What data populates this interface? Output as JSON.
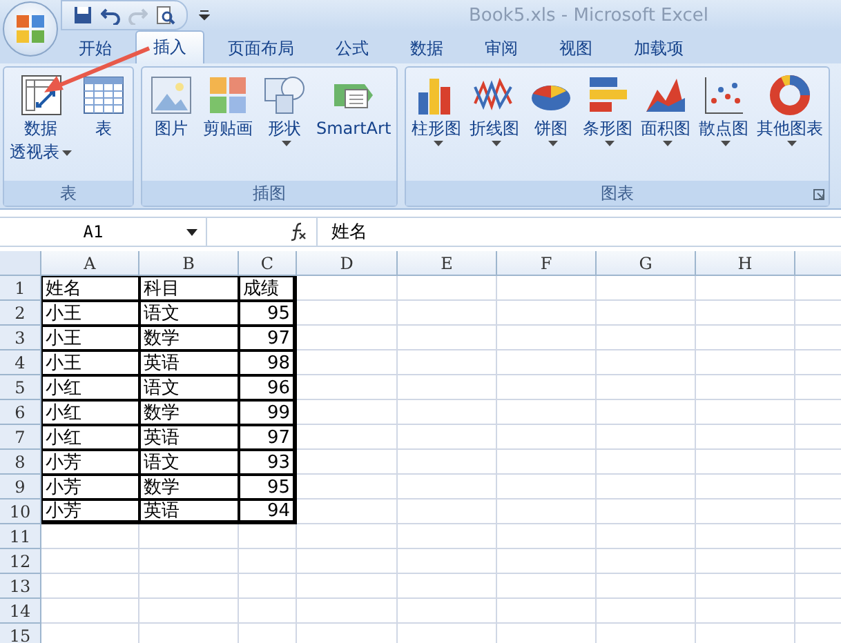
{
  "window": {
    "title": "Book5.xls  -  Microsoft Excel"
  },
  "quick_access": [
    {
      "disabled": false
    },
    {
      "disabled": false
    },
    {
      "disabled": true
    },
    {
      "disabled": false
    }
  ],
  "tabs": [
    {
      "label": "开始",
      "selected": false
    },
    {
      "label": "插入",
      "selected": true
    },
    {
      "label": "页面布局",
      "selected": false
    },
    {
      "label": "公式",
      "selected": false
    },
    {
      "label": "数据",
      "selected": false
    },
    {
      "label": "审阅",
      "selected": false
    },
    {
      "label": "视图",
      "selected": false
    },
    {
      "label": "加载项",
      "selected": false
    }
  ],
  "ribbon": [
    {
      "label": "表",
      "launcher": false,
      "buttons": [
        {
          "lines": [
            "数据",
            "透视表"
          ],
          "dropdown": true
        },
        {
          "lines": [
            "表"
          ],
          "dropdown": false
        }
      ]
    },
    {
      "label": "插图",
      "launcher": false,
      "buttons": [
        {
          "lines": [
            "图片"
          ],
          "dropdown": false
        },
        {
          "lines": [
            "剪贴画"
          ],
          "dropdown": false
        },
        {
          "lines": [
            "形状"
          ],
          "dropdown": true
        },
        {
          "lines": [
            "SmartArt"
          ],
          "dropdown": false
        }
      ]
    },
    {
      "label": "图表",
      "launcher": true,
      "buttons": [
        {
          "lines": [
            "柱形图"
          ],
          "dropdown": true
        },
        {
          "lines": [
            "折线图"
          ],
          "dropdown": true
        },
        {
          "lines": [
            "饼图"
          ],
          "dropdown": true
        },
        {
          "lines": [
            "条形图"
          ],
          "dropdown": true
        },
        {
          "lines": [
            "面积图"
          ],
          "dropdown": true
        },
        {
          "lines": [
            "散点图"
          ],
          "dropdown": true
        },
        {
          "lines": [
            "其他图表"
          ],
          "dropdown": true
        }
      ]
    }
  ],
  "name_box": "A1",
  "formula": "姓名",
  "columns": [
    "A",
    "B",
    "C",
    "D",
    "E",
    "F",
    "G",
    "H"
  ],
  "rows": [
    {
      "number": "1",
      "kind": "header",
      "cells": [
        "姓名",
        "科目",
        "成绩"
      ]
    },
    {
      "number": "2",
      "kind": "record",
      "cells": [
        "小王",
        "语文",
        "95"
      ]
    },
    {
      "number": "3",
      "kind": "record",
      "cells": [
        "小王",
        "数学",
        "97"
      ]
    },
    {
      "number": "4",
      "kind": "record",
      "cells": [
        "小王",
        "英语",
        "98"
      ]
    },
    {
      "number": "5",
      "kind": "record",
      "cells": [
        "小红",
        "语文",
        "96"
      ]
    },
    {
      "number": "6",
      "kind": "record",
      "cells": [
        "小红",
        "数学",
        "99"
      ]
    },
    {
      "number": "7",
      "kind": "record",
      "cells": [
        "小红",
        "英语",
        "97"
      ]
    },
    {
      "number": "8",
      "kind": "record",
      "cells": [
        "小芳",
        "语文",
        "93"
      ]
    },
    {
      "number": "9",
      "kind": "record",
      "cells": [
        "小芳",
        "数学",
        "95"
      ]
    },
    {
      "number": "10",
      "kind": "record",
      "cells": [
        "小芳",
        "英语",
        "94"
      ]
    },
    {
      "number": "11",
      "kind": "empty",
      "cells": []
    },
    {
      "number": "12",
      "kind": "empty",
      "cells": []
    },
    {
      "number": "13",
      "kind": "empty",
      "cells": []
    },
    {
      "number": "14",
      "kind": "empty",
      "cells": []
    },
    {
      "number": "15",
      "kind": "empty",
      "cells": []
    }
  ]
}
